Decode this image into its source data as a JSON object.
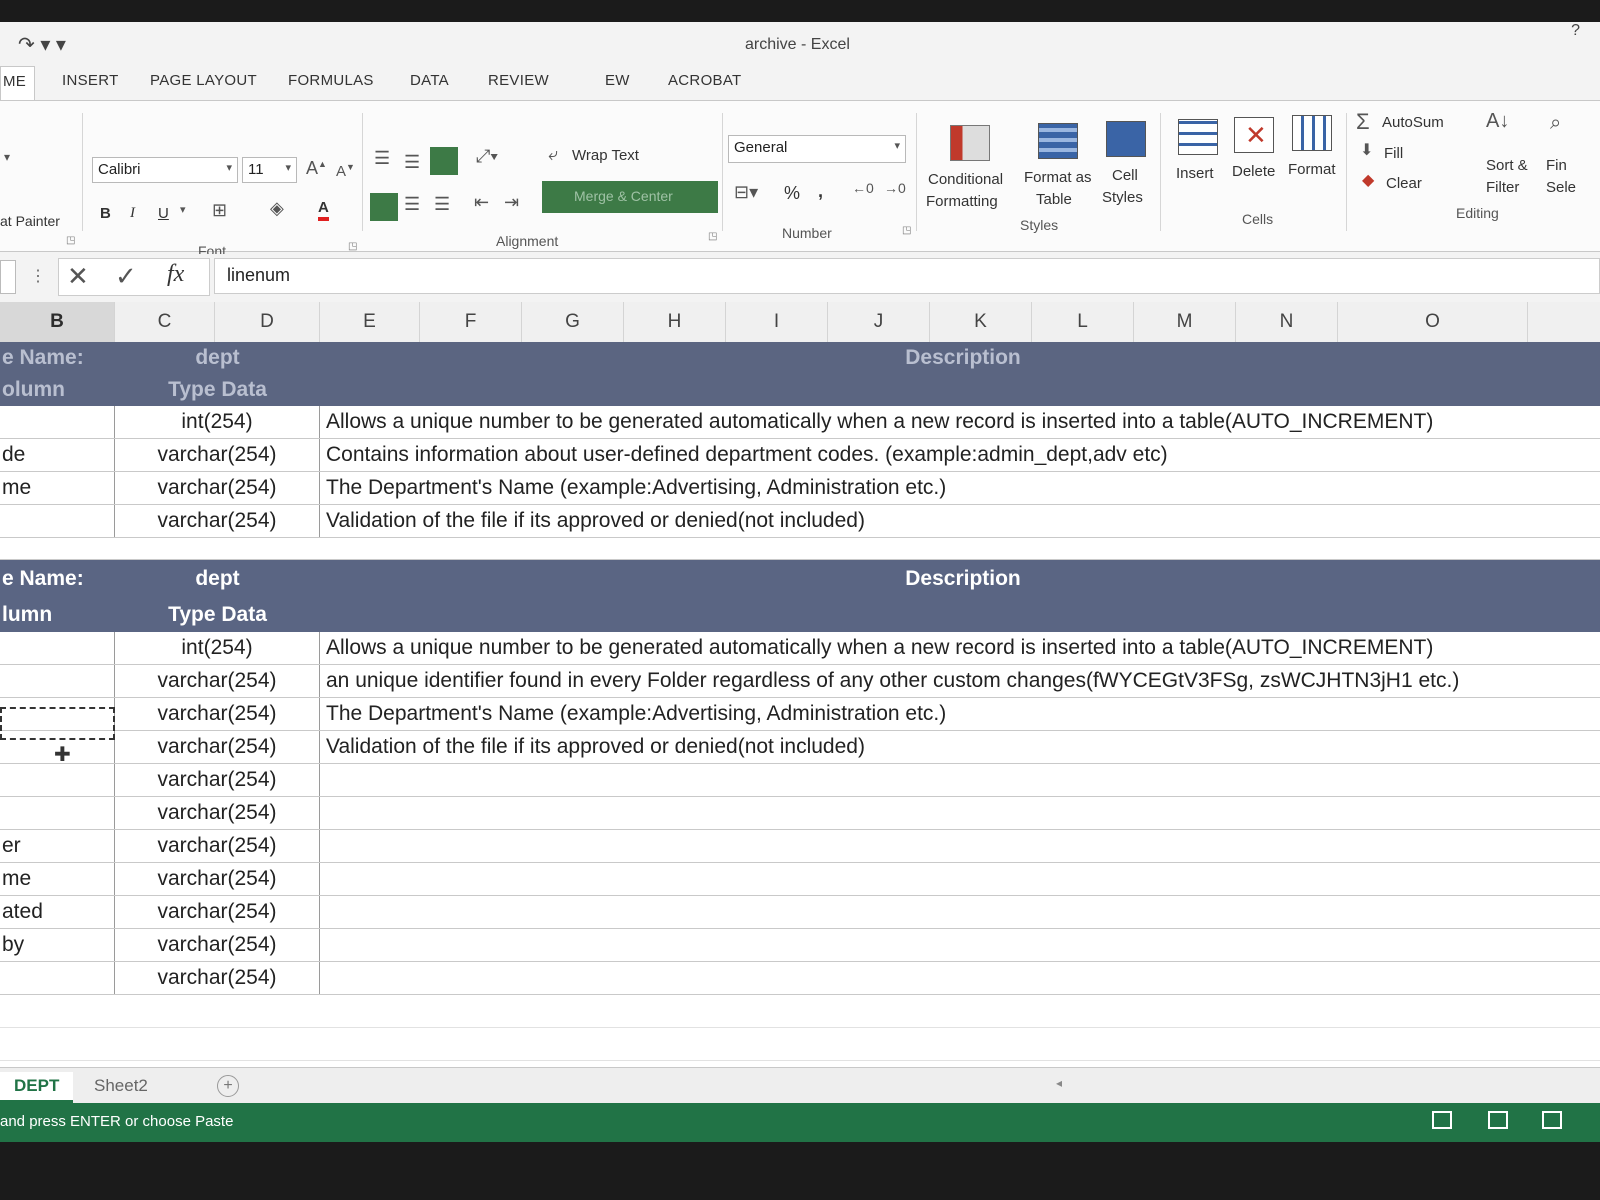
{
  "window": {
    "title": "archive - Excel",
    "help": "?"
  },
  "tabs": [
    {
      "label": "ME",
      "active": true
    },
    {
      "label": "INSERT"
    },
    {
      "label": "PAGE LAYOUT"
    },
    {
      "label": "FORMULAS"
    },
    {
      "label": "DATA"
    },
    {
      "label": "REVIEW"
    },
    {
      "label": "EW"
    },
    {
      "label": "ACROBAT"
    }
  ],
  "ribbon": {
    "clipboard": {
      "format_painter": "at Painter"
    },
    "font": {
      "label": "Font",
      "name": "Calibri",
      "size": "11",
      "bold": "B",
      "italic": "I",
      "underline": "U",
      "color_glyph": "A"
    },
    "alignment": {
      "label": "Alignment",
      "wrap_text": "Wrap Text",
      "merge_center": "Merge & Center"
    },
    "number": {
      "label": "Number",
      "format": "General",
      "percent": "%",
      "comma": ","
    },
    "styles": {
      "label": "Styles",
      "conditional_1": "Conditional",
      "conditional_2": "Formatting",
      "format_table_1": "Format as",
      "format_table_2": "Table",
      "cell_styles_1": "Cell",
      "cell_styles_2": "Styles"
    },
    "cells": {
      "label": "Cells",
      "insert": "Insert",
      "delete": "Delete",
      "format": "Format"
    },
    "editing": {
      "label": "Editing",
      "autosum": "AutoSum",
      "fill": "Fill",
      "clear": "Clear",
      "sort_1": "Sort &",
      "sort_2": "Filter",
      "find_1": "Fin",
      "find_2": "Sele"
    }
  },
  "formula_bar": {
    "value": "linenum",
    "fx": "fx"
  },
  "columns": [
    "B",
    "C",
    "D",
    "E",
    "F",
    "G",
    "H",
    "I",
    "J",
    "K",
    "L",
    "M",
    "N",
    "O"
  ],
  "selected_column": "B",
  "table1": {
    "header1": {
      "b": "e Name:",
      "c": "dept",
      "e": "Description"
    },
    "header2": {
      "b": "olumn",
      "c": "Type Data"
    },
    "rows": [
      {
        "b": "",
        "c": "int(254)",
        "e": "Allows a unique number to be generated automatically when a new record is inserted into a table(AUTO_INCREMENT)"
      },
      {
        "b": "de",
        "c": "varchar(254)",
        "e": "Contains information about user-defined department codes. (example:admin_dept,adv etc)"
      },
      {
        "b": "me",
        "c": "varchar(254)",
        "e": "The Department's Name (example:Advertising, Administration etc.)"
      },
      {
        "b": "",
        "c": "varchar(254)",
        "e": "Validation of the file if its approved or denied(not included)"
      }
    ]
  },
  "table2": {
    "header1": {
      "b": "e Name:",
      "c": "dept",
      "e": "Description"
    },
    "header2": {
      "b": "lumn",
      "c": "Type Data"
    },
    "rows": [
      {
        "b": "",
        "c": "int(254)",
        "e": "Allows a unique number to be generated automatically when a new record is inserted into a table(AUTO_INCREMENT)"
      },
      {
        "b": "",
        "c": "varchar(254)",
        "e": "an unique identifier found in every Folder regardless of any other custom changes(fWYCEGtV3FSg, zsWCJHTN3jH1 etc.)"
      },
      {
        "b": "",
        "c": "varchar(254)",
        "e": "The Department's Name (example:Advertising, Administration etc.)"
      },
      {
        "b": "",
        "c": "varchar(254)",
        "e": "Validation of the file if its approved or denied(not included)"
      },
      {
        "b": "",
        "c": "varchar(254)",
        "e": ""
      },
      {
        "b": "",
        "c": "varchar(254)",
        "e": ""
      },
      {
        "b": "er",
        "c": "varchar(254)",
        "e": ""
      },
      {
        "b": "me",
        "c": "varchar(254)",
        "e": ""
      },
      {
        "b": "ated",
        "c": "varchar(254)",
        "e": ""
      },
      {
        "b": "by",
        "c": "varchar(254)",
        "e": ""
      },
      {
        "b": "",
        "c": "varchar(254)",
        "e": ""
      }
    ]
  },
  "sheets": [
    {
      "name": "DEPT",
      "active": true
    },
    {
      "name": "Sheet2"
    }
  ],
  "status": {
    "text": "and press ENTER or choose Paste"
  },
  "colors": {
    "header_fill": "#5a6583",
    "status_green": "#217346"
  }
}
